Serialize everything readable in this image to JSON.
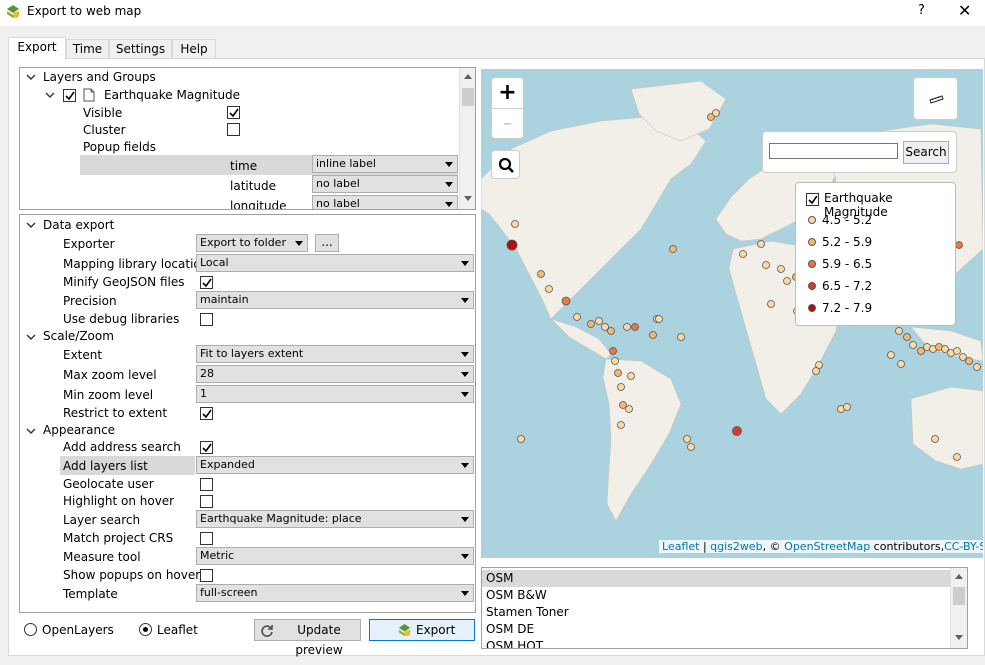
{
  "window": {
    "title": "Export to web map",
    "help": "?",
    "close": "✕"
  },
  "tabs": [
    "Export",
    "Time",
    "Settings",
    "Help"
  ],
  "layers_panel": {
    "root_label": "Layers and Groups",
    "layer_name": "Earthquake Magnitude",
    "visible_label": "Visible",
    "cluster_label": "Cluster",
    "popup_fields_label": "Popup fields",
    "fields": [
      {
        "name": "time",
        "mode": "inline label"
      },
      {
        "name": "latitude",
        "mode": "no label"
      },
      {
        "name": "longitude",
        "mode": "no label"
      }
    ]
  },
  "settings_panel": {
    "data_export": "Data export",
    "exporter": {
      "label": "Exporter",
      "value": "Export to folder",
      "browse": "..."
    },
    "mapping_library": {
      "label": "Mapping library location",
      "value": "Local"
    },
    "minify": {
      "label": "Minify GeoJSON files"
    },
    "precision": {
      "label": "Precision",
      "value": "maintain"
    },
    "debug": {
      "label": "Use debug libraries"
    },
    "scale_zoom": "Scale/Zoom",
    "extent": {
      "label": "Extent",
      "value": "Fit to layers extent"
    },
    "max_zoom": {
      "label": "Max zoom level",
      "value": "28"
    },
    "min_zoom": {
      "label": "Min zoom level",
      "value": "1"
    },
    "restrict": {
      "label": "Restrict to extent"
    },
    "appearance": "Appearance",
    "address_search": {
      "label": "Add address search"
    },
    "layers_list": {
      "label": "Add layers list",
      "value": "Expanded"
    },
    "geolocate": {
      "label": "Geolocate user"
    },
    "highlight": {
      "label": "Highlight on hover"
    },
    "layer_search": {
      "label": "Layer search",
      "value": "Earthquake Magnitude: place"
    },
    "match_crs": {
      "label": "Match project CRS"
    },
    "measure": {
      "label": "Measure tool",
      "value": "Metric"
    },
    "show_popups": {
      "label": "Show popups on hover"
    },
    "template": {
      "label": "Template",
      "value": "full-screen"
    }
  },
  "bottom": {
    "openlayers": "OpenLayers",
    "leaflet": "Leaflet",
    "update_preview": "Update preview",
    "export": "Export"
  },
  "map": {
    "zoom_in": "+",
    "zoom_out": "–",
    "search_button": "Search",
    "legend_title": "Earthquake Magnitude",
    "legend": [
      {
        "label": "4.5 - 5.2",
        "color": "#fbd9a4"
      },
      {
        "label": "5.2 - 5.9",
        "color": "#f4b76d"
      },
      {
        "label": "5.9 - 6.5",
        "color": "#e8774a"
      },
      {
        "label": "6.5 - 7.2",
        "color": "#d63b2e"
      },
      {
        "label": "7.2 - 7.9",
        "color": "#b30d0d"
      }
    ],
    "attribution": {
      "leaflet": "Leaflet",
      "sep1": " | ",
      "qgis2web": "qgis2web",
      "sep2": ", © ",
      "osm": "OpenStreetMap",
      "contrib": " contributors,",
      "license": "CC-BY-SA",
      "end": ","
    }
  },
  "basemaps": [
    "OSM",
    "OSM B&W",
    "Stamen Toner",
    "OSM DE",
    "OSM HOT"
  ],
  "colors": {
    "accent": "#0078d7",
    "map_water": "#aad3df",
    "map_land": "#f2efe9"
  }
}
